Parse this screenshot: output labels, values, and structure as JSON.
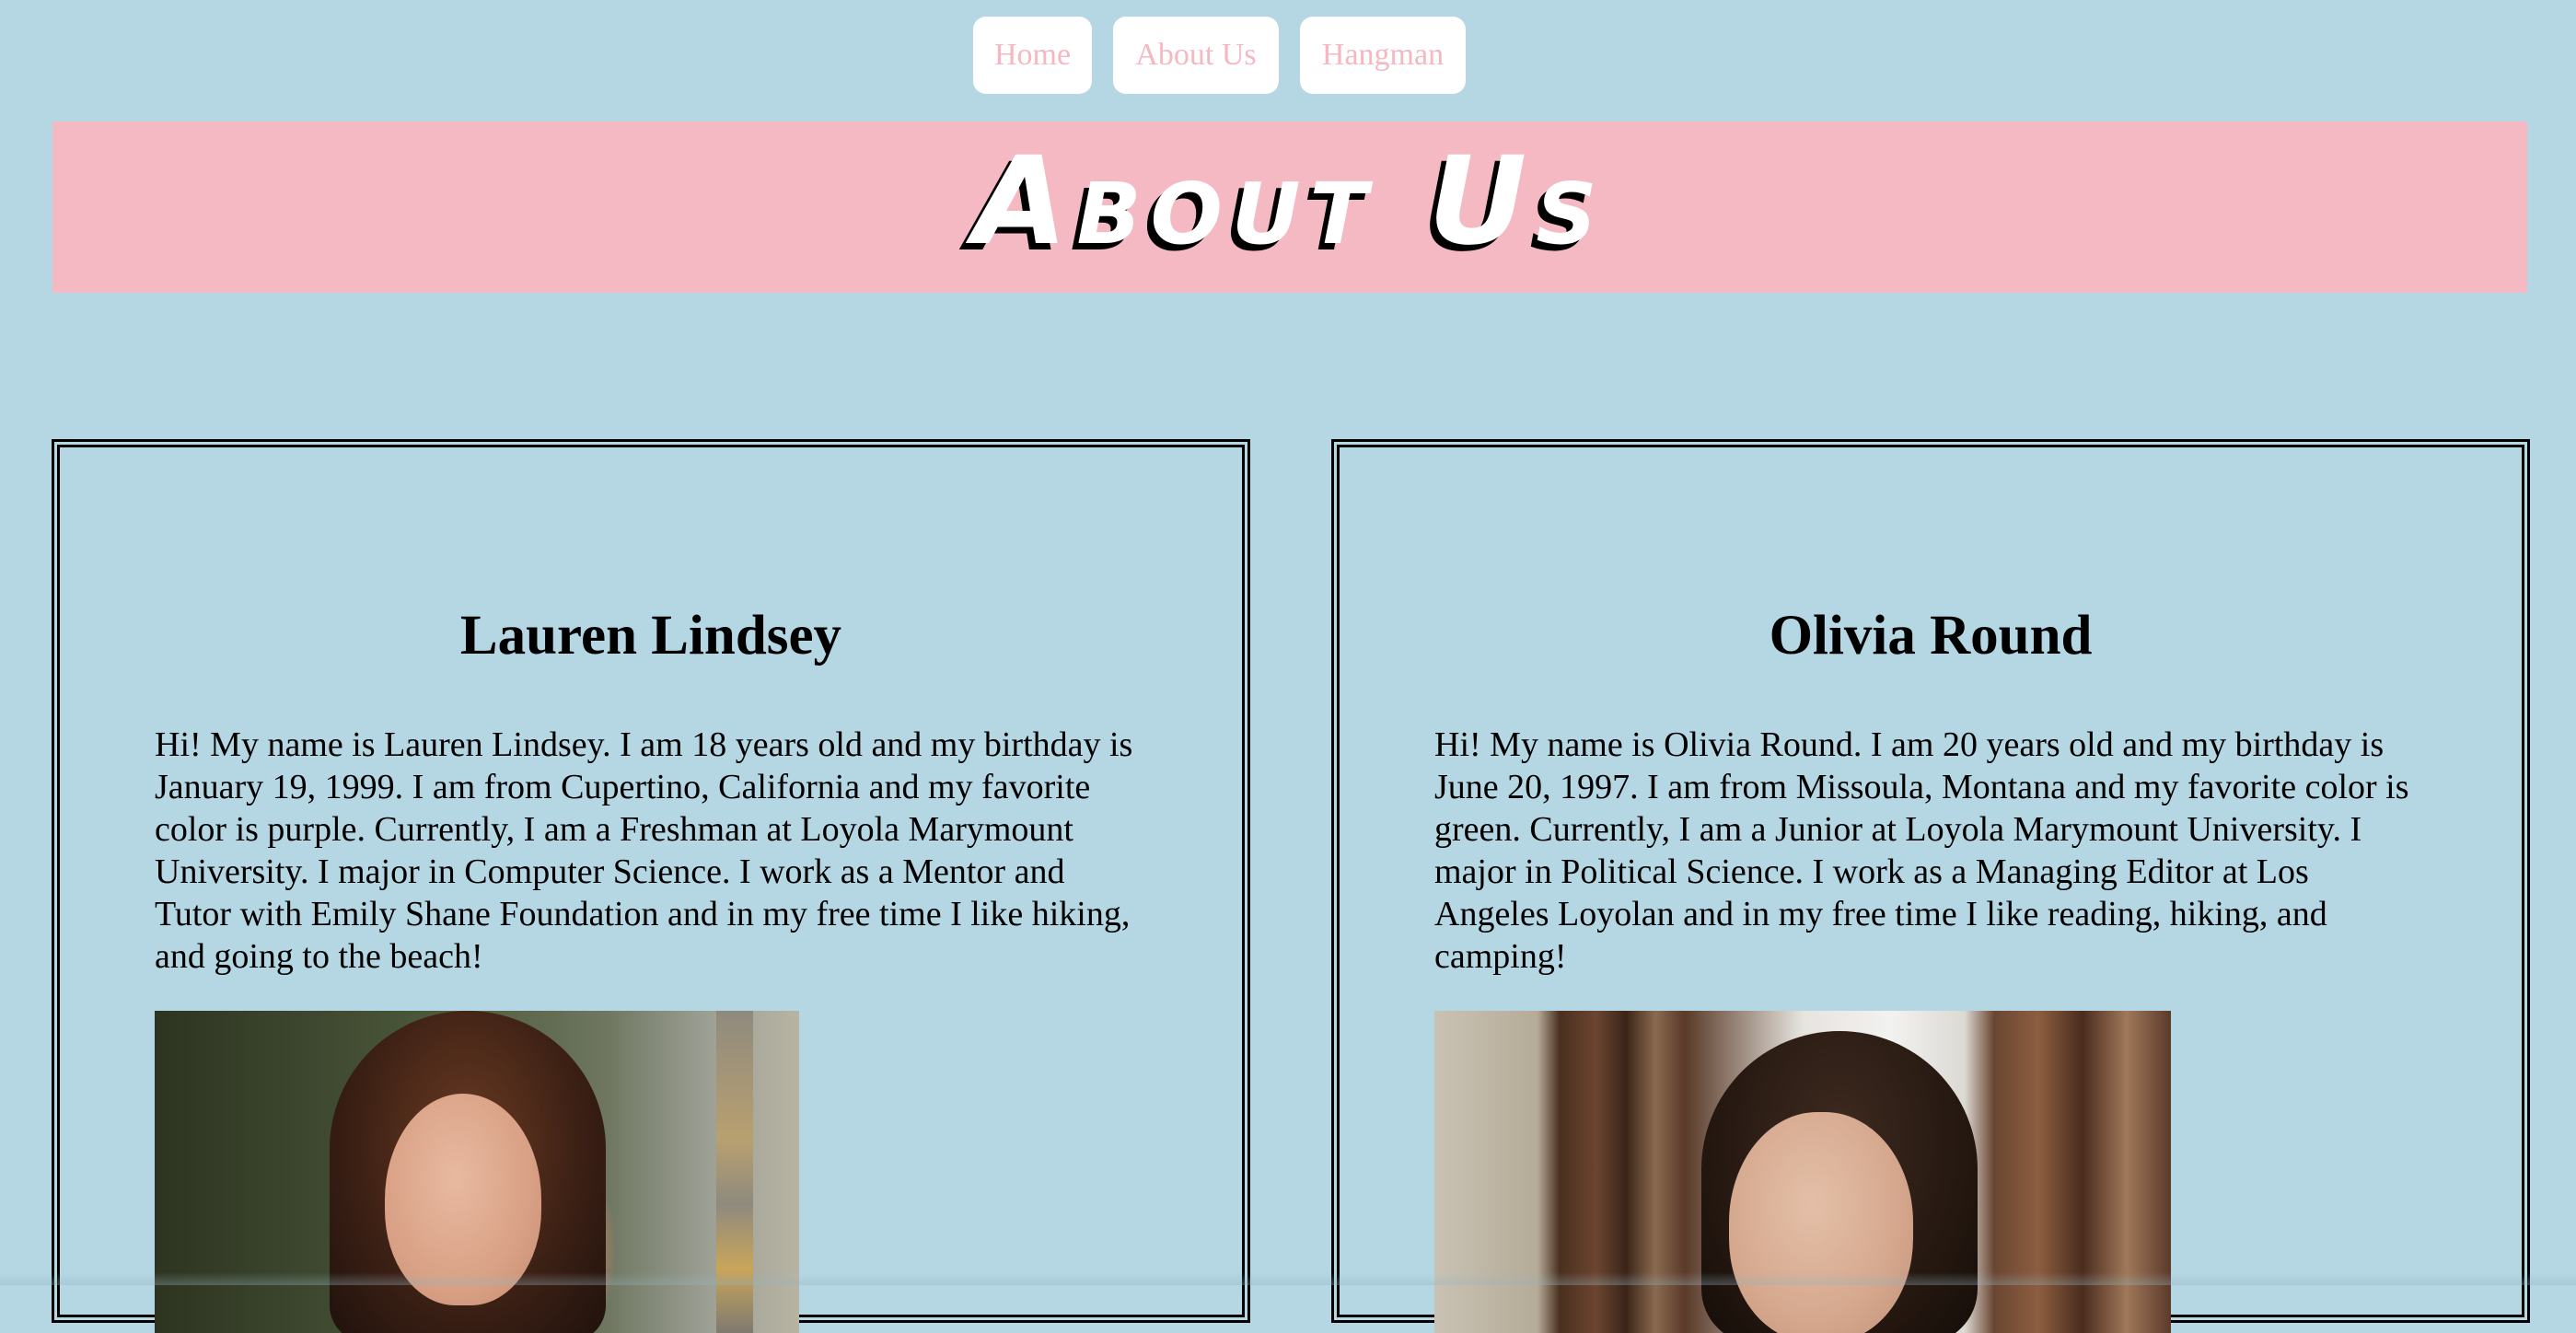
{
  "nav": {
    "home_label": "Home",
    "about_label": "About Us",
    "hangman_label": "Hangman"
  },
  "header": {
    "title": "About Us"
  },
  "profiles": [
    {
      "name": "Lauren Lindsey",
      "bio": "Hi! My name is Lauren Lindsey. I am 18 years old and my birthday is January 19, 1999. I am from Cupertino, California and my favorite color is purple. Currently, I am a Freshman at Loyola Marymount University. I major in Computer Science. I work as a Mentor and Tutor with Emily Shane Foundation and in my free time I like hiking, and going to the beach!"
    },
    {
      "name": "Olivia Round",
      "bio": "Hi! My name is Olivia Round. I am 20 years old and my birthday is June 20, 1997. I am from Missoula, Montana and my favorite color is green. Currently, I am a Junior at Loyola Marymount University. I major in Political Science. I work as a Managing Editor at Los Angeles Loyolan and in my free time I like reading, hiking, and camping!"
    }
  ],
  "colors": {
    "page_background": "#b5d7e3",
    "banner_background": "#f5b9c3",
    "nav_text": "#f4b8c2",
    "nav_background": "#ffffff",
    "title_text": "#ffffff",
    "title_shadow": "#000000"
  }
}
